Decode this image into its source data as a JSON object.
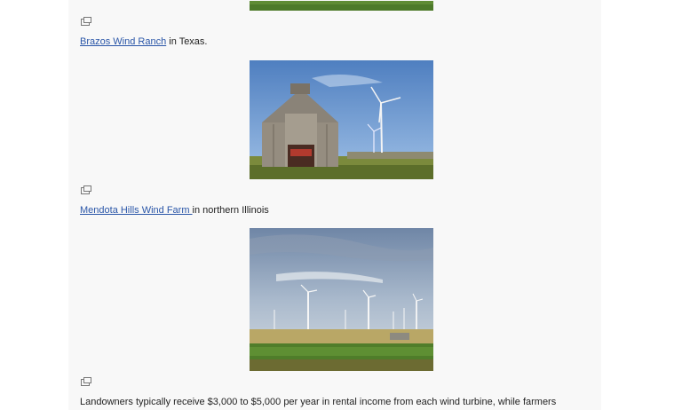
{
  "captions": [
    {
      "link": "Brazos Wind Ranch",
      "text": " in Texas."
    },
    {
      "link": "Mendota Hills Wind Farm ",
      "text": "in northern Illinois"
    }
  ],
  "paragraph": "Landowners typically receive $3,000 to $5,000 per year in rental income from each wind turbine, while farmers",
  "icons": {
    "enlarge": "enlarge-icon"
  }
}
